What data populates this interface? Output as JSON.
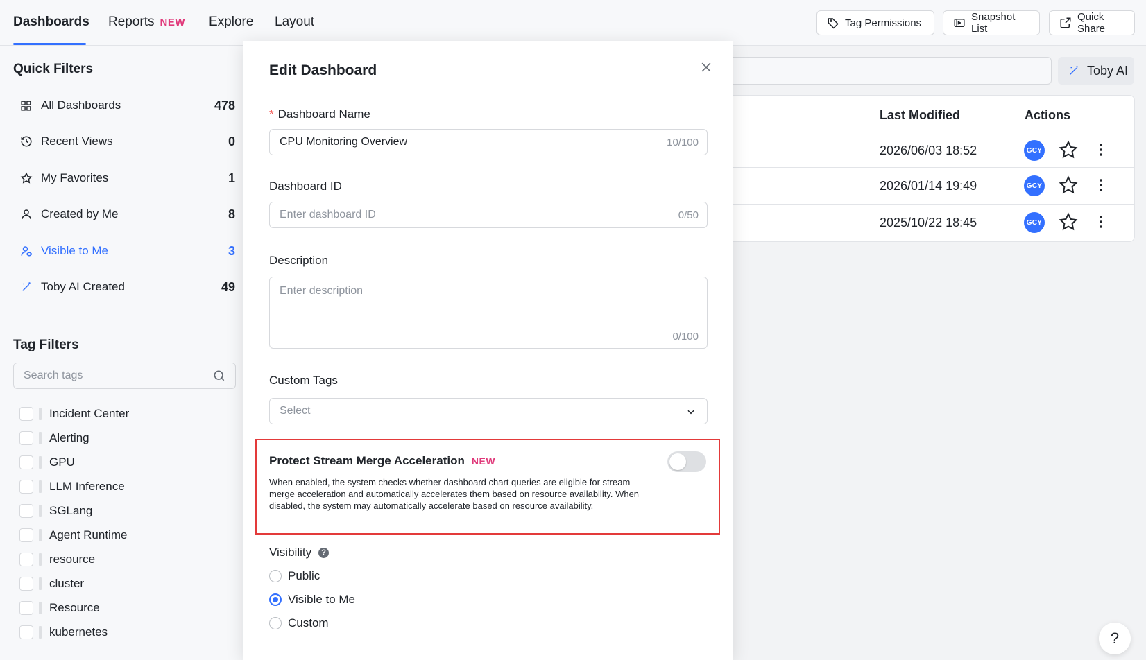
{
  "nav": {
    "tabs": [
      {
        "label": "Dashboards"
      },
      {
        "label": "Reports",
        "badge": "NEW"
      },
      {
        "label": "Explore"
      },
      {
        "label": "Layout"
      }
    ],
    "buttons": {
      "tag_permissions": "Tag Permissions",
      "snapshot_list": "Snapshot List",
      "quick_share": "Quick Share"
    }
  },
  "sidebar": {
    "quick_filters_title": "Quick Filters",
    "quick_filters": [
      {
        "label": "All Dashboards",
        "count": "478",
        "icon": "grid-icon"
      },
      {
        "label": "Recent Views",
        "count": "0",
        "icon": "history-icon"
      },
      {
        "label": "My Favorites",
        "count": "1",
        "icon": "star-icon"
      },
      {
        "label": "Created by Me",
        "count": "8",
        "icon": "user-icon"
      },
      {
        "label": "Visible to Me",
        "count": "3",
        "icon": "user-eye-icon",
        "active": true
      },
      {
        "label": "Toby AI Created",
        "count": "49",
        "icon": "magic-wand-icon"
      }
    ],
    "tag_filters_title": "Tag Filters",
    "tag_search_placeholder": "Search tags",
    "tags": [
      "Incident Center",
      "Alerting",
      "GPU",
      "LLM Inference",
      "SGLang",
      "Agent Runtime",
      "resource",
      "cluster",
      "Resource",
      "kubernetes"
    ]
  },
  "toolbar": {
    "toby_ai_label": "Toby AI"
  },
  "table": {
    "headers": {
      "last_modified": "Last Modified",
      "actions": "Actions"
    },
    "rows": [
      {
        "last_modified": "2026/06/03 18:52",
        "owner": "GCY"
      },
      {
        "last_modified": "2026/01/14 19:49",
        "owner": "GCY"
      },
      {
        "last_modified": "2025/10/22 18:45",
        "owner": "GCY"
      }
    ]
  },
  "modal": {
    "title": "Edit Dashboard",
    "name": {
      "required_mark": "*",
      "label": "Dashboard Name",
      "value": "CPU Monitoring Overview",
      "counter": "10/100"
    },
    "dashboard_id": {
      "label": "Dashboard ID",
      "placeholder": "Enter dashboard ID",
      "counter": "0/50"
    },
    "description": {
      "label": "Description",
      "placeholder": "Enter description",
      "counter": "0/100"
    },
    "custom_tags": {
      "label": "Custom Tags",
      "placeholder": "Select"
    },
    "protect_stream": {
      "title": "Protect Stream Merge Acceleration",
      "badge": "NEW",
      "enabled": false,
      "description": "When enabled, the system checks whether dashboard chart queries are eligible for stream merge acceleration and automatically accelerates them based on resource availability. When disabled, the system may automatically accelerate based on resource availability."
    },
    "visibility": {
      "label": "Visibility",
      "help": "?",
      "options": [
        {
          "label": "Public",
          "checked": false
        },
        {
          "label": "Visible to Me",
          "checked": true
        },
        {
          "label": "Custom",
          "checked": false
        }
      ]
    }
  },
  "help_button": "?",
  "colors": {
    "accent": "#3370ff",
    "badge": "#e0397a",
    "highlight_border": "#e33a3a"
  }
}
